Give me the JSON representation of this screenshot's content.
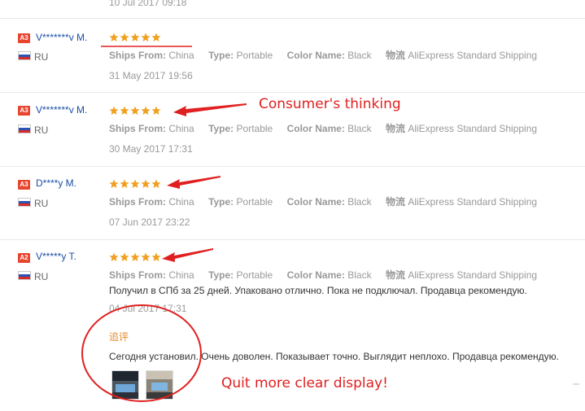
{
  "top_date": "10 Jul 2017 09:18",
  "labels": {
    "ships_from": "Ships From:",
    "type": "Type:",
    "color_name": "Color Name:",
    "shipping": "物流"
  },
  "reviews": [
    {
      "badge": "A3",
      "name": "V*******v M.",
      "country": "RU",
      "stars": 5,
      "ships_from": "China",
      "type": "Portable",
      "color_name": "Black",
      "shipping": "AliExpress Standard Shipping",
      "date": "31 May 2017 19:56"
    },
    {
      "badge": "A3",
      "name": "V*******v M.",
      "country": "RU",
      "stars": 5,
      "ships_from": "China",
      "type": "Portable",
      "color_name": "Black",
      "shipping": "AliExpress Standard Shipping",
      "date": "30 May 2017 17:31"
    },
    {
      "badge": "A3",
      "name": "D****y M.",
      "country": "RU",
      "stars": 5,
      "ships_from": "China",
      "type": "Portable",
      "color_name": "Black",
      "shipping": "AliExpress Standard Shipping",
      "date": "07 Jun 2017 23:22"
    },
    {
      "badge": "A2",
      "name": "V*****y T.",
      "country": "RU",
      "stars": 5,
      "ships_from": "China",
      "type": "Portable",
      "color_name": "Black",
      "shipping": "AliExpress Standard Shipping",
      "text": "Получил в СПб за 25 дней. Упаковано отлично. Пока не подключал. Продавца рекомендую.",
      "date": "04 Jul 2017 17:31",
      "append_label": "追评",
      "append_text": "Сегодня установил. Очень доволен. Показывает точно. Выглядит неплохо. Продавца рекомендую."
    }
  ],
  "annotations": {
    "consumer": "Consumer's thinking",
    "display": "Quit more clear display!"
  },
  "colors": {
    "annotation_red": "#e02020",
    "star_orange": "#f0a020",
    "name_blue": "#1a4fa6",
    "badge_red": "#e8452f"
  }
}
